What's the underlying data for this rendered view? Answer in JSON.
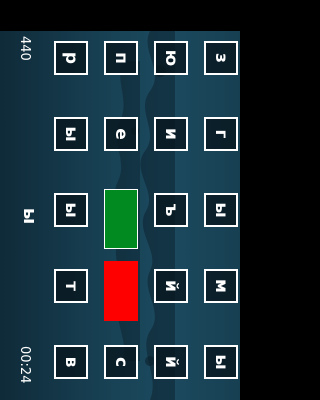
{
  "hud": {
    "score": "440",
    "timer": "00:24",
    "current_word": "ы"
  },
  "rows": [
    {
      "row": "top",
      "tiles": [
        "з",
        "г",
        "ы",
        "м",
        "ы"
      ]
    },
    {
      "row": "second",
      "tiles": [
        "ю",
        "и",
        "ъ",
        "й",
        "й"
      ]
    },
    {
      "row": "third",
      "tiles": [
        "п",
        "е",
        "",
        "",
        "с"
      ]
    },
    {
      "row": "bottom",
      "tiles": [
        "р",
        "ы",
        "ы",
        "т",
        "в"
      ]
    }
  ],
  "blocks": {
    "green_color": "#008a1f",
    "red_color": "#ff0000"
  }
}
